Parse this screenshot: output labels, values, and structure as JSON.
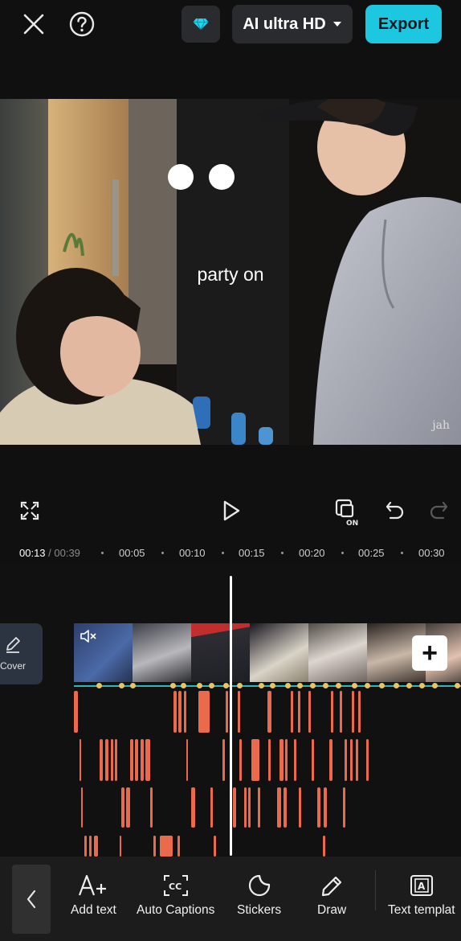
{
  "header": {
    "quality_label": "AI ultra HD",
    "export_label": "Export",
    "icons": [
      "close-icon",
      "help-icon",
      "diamond-icon",
      "caret-down-icon"
    ],
    "accent_color": "#1ec7e0"
  },
  "preview": {
    "caption": "party on",
    "watermark": "jah"
  },
  "controls": {
    "icons": [
      "fullscreen-icon",
      "play-icon",
      "keyframe-on-icon",
      "undo-icon",
      "redo-icon"
    ]
  },
  "timeline": {
    "current_time": "00:13",
    "total_time": " / 00:39",
    "ticks": [
      "00:05",
      "00:10",
      "00:15",
      "00:20",
      "00:25",
      "00:30"
    ],
    "cover_label": "Cover",
    "add_label": "+"
  },
  "toolbar": {
    "items": [
      {
        "label": "Add text",
        "icon": "add-text-icon"
      },
      {
        "label": "Auto Captions",
        "icon": "auto-captions-icon"
      },
      {
        "label": "Stickers",
        "icon": "sticker-icon"
      },
      {
        "label": "Draw",
        "icon": "pencil-icon"
      },
      {
        "label": "Text templat",
        "icon": "text-template-icon"
      }
    ]
  }
}
